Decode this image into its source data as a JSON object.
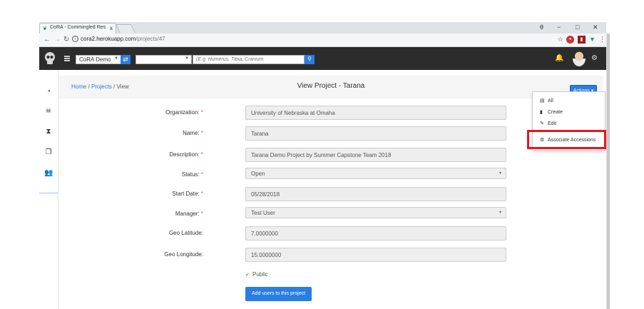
{
  "browser": {
    "tab_title": "CoRA - Commingled Res",
    "tab_close": "x",
    "url_host": "cora2.herokuapp.com",
    "url_path": "/projects/47",
    "window_controls": [
      "θ",
      "−",
      "□",
      "✕"
    ]
  },
  "navbar": {
    "org_select": "CoRA Demo",
    "search_placeholder": "(E.g. Humerus, Tibia, Cranium",
    "swap_icon": "⇄",
    "search_icon": "🔍"
  },
  "sidebar": {
    "icons": [
      "dashboard-icon",
      "skull-icon",
      "hourglass-icon",
      "copy-icon",
      "users-icon"
    ]
  },
  "header": {
    "breadcrumb_home": "Home",
    "breadcrumb_sep1": " / ",
    "breadcrumb_projects": "Projects",
    "breadcrumb_sep2": " / ",
    "breadcrumb_current": "View",
    "title": "View Project - Tarana",
    "actions_label": "Actions"
  },
  "actions_menu": {
    "items": [
      {
        "label": "All",
        "icon": "list-icon"
      },
      {
        "label": "Create",
        "icon": "file-icon"
      },
      {
        "label": "Edit",
        "icon": "edit-icon"
      },
      {
        "label": "Associate Accessions",
        "icon": "gear-icon"
      }
    ],
    "highlight_color": "#e8141a"
  },
  "form": {
    "required_mark": "*",
    "fields": [
      {
        "label": "Organization:",
        "value": "University of Nebraska at Omaha",
        "required": true,
        "type": "text"
      },
      {
        "label": "Name:",
        "value": "Tarana",
        "required": true,
        "type": "text"
      },
      {
        "label": "Description:",
        "value": "Tarana Demo Project by Summer Capstone Team 2018",
        "required": true,
        "type": "text"
      },
      {
        "label": "Status:",
        "value": "Open",
        "required": true,
        "type": "select"
      },
      {
        "label": "Start Date:",
        "value": "05/28/2018",
        "required": true,
        "type": "text"
      },
      {
        "label": "Manager:",
        "value": "Test User",
        "required": true,
        "type": "select"
      },
      {
        "label": "Geo Latitude:",
        "value": "7.0000000",
        "required": false,
        "type": "text"
      },
      {
        "label": "Geo Longitude:",
        "value": "15.0000000",
        "required": false,
        "type": "text"
      }
    ],
    "public_label": "Public",
    "public_checked": true,
    "add_users_label": "Add users to this project"
  },
  "colors": {
    "primary": "#2a7de1",
    "navbar": "#2c2c2c",
    "required": "#d9534f"
  }
}
